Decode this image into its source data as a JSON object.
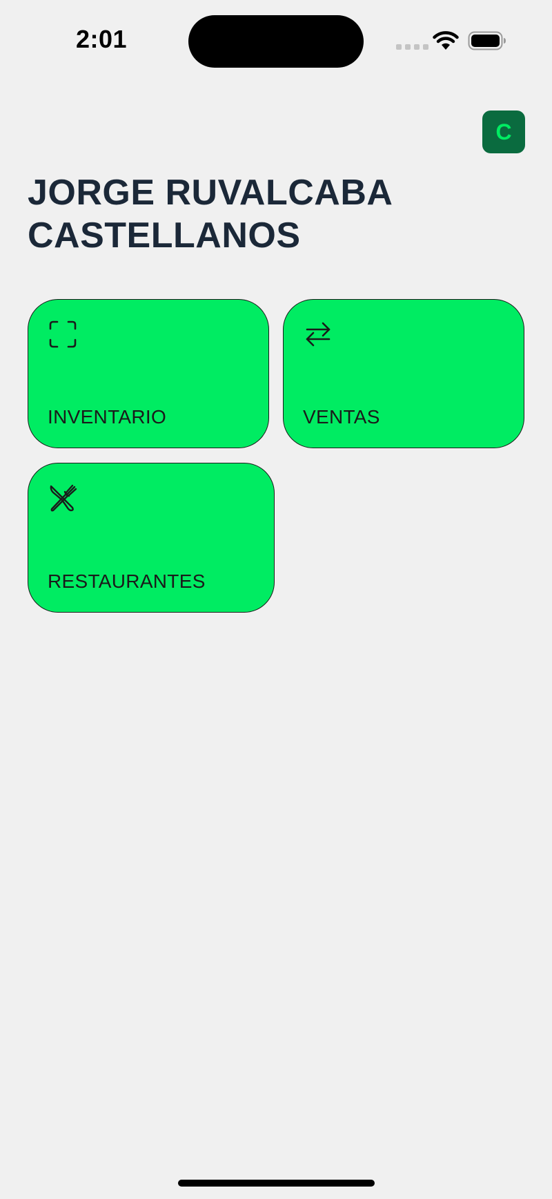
{
  "status_bar": {
    "time": "2:01",
    "icons": [
      "signal-dots-icon",
      "wifi-icon",
      "battery-icon"
    ]
  },
  "header": {
    "avatar_initial": "C",
    "avatar_bg": "#0a6b3f",
    "avatar_fg": "#00ec62"
  },
  "user": {
    "name": "JORGE RUVALCABA CASTELLANOS"
  },
  "menu": {
    "tile_color": "#00ec62",
    "items": [
      {
        "label": "INVENTARIO",
        "icon": "scan-frame-icon"
      },
      {
        "label": "VENTAS",
        "icon": "swap-arrows-icon"
      },
      {
        "label": "RESTAURANTES",
        "icon": "knife-fork-icon"
      }
    ]
  }
}
